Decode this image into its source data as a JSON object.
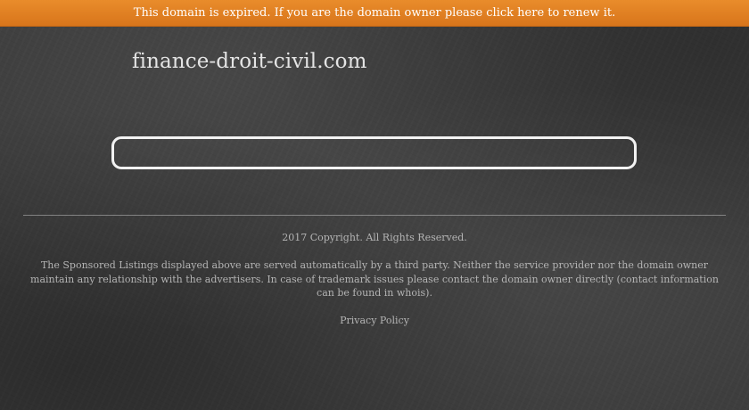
{
  "banner": {
    "text": "This domain is expired. If you are the domain owner please click here to renew it.",
    "background_color": "#e07f22"
  },
  "header": {
    "site_title": "finance-droit-civil.com"
  },
  "search": {
    "value": ""
  },
  "footer": {
    "copyright": "2017 Copyright. All Rights Reserved.",
    "disclaimer": "The Sponsored Listings displayed above are served automatically by a third party. Neither the service provider nor the domain owner maintain any relationship with the advertisers. In case of trademark issues please contact the domain owner directly (contact information can be found in whois).",
    "privacy_link": "Privacy Policy"
  }
}
